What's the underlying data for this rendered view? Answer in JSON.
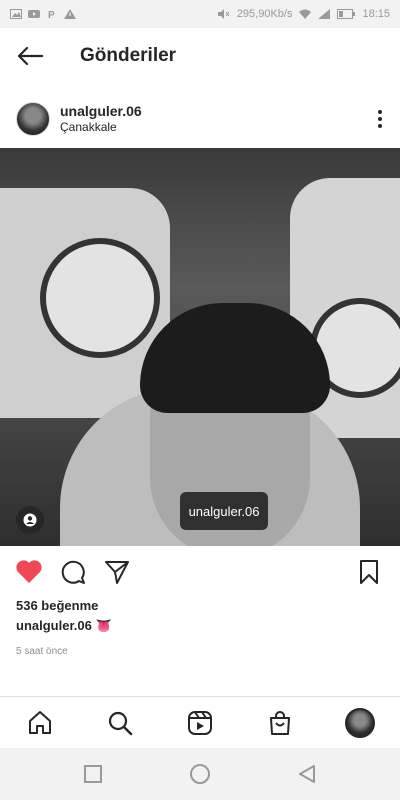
{
  "status_bar": {
    "network_speed": "295,90Kb/s",
    "time": "18:15"
  },
  "header": {
    "title": "Gönderiler"
  },
  "post": {
    "username": "unalguler.06",
    "location": "Çanakkale",
    "tag_label": "unalguler.06",
    "likes": "536 beğenme",
    "caption_user": "unalguler.06",
    "caption_emoji": "👅",
    "time_ago": "5 saat önce",
    "liked": true,
    "like_color": "#ed4956"
  },
  "bottom_nav": [
    "home-icon",
    "search-icon",
    "reels-icon",
    "shop-icon",
    "profile-avatar"
  ]
}
